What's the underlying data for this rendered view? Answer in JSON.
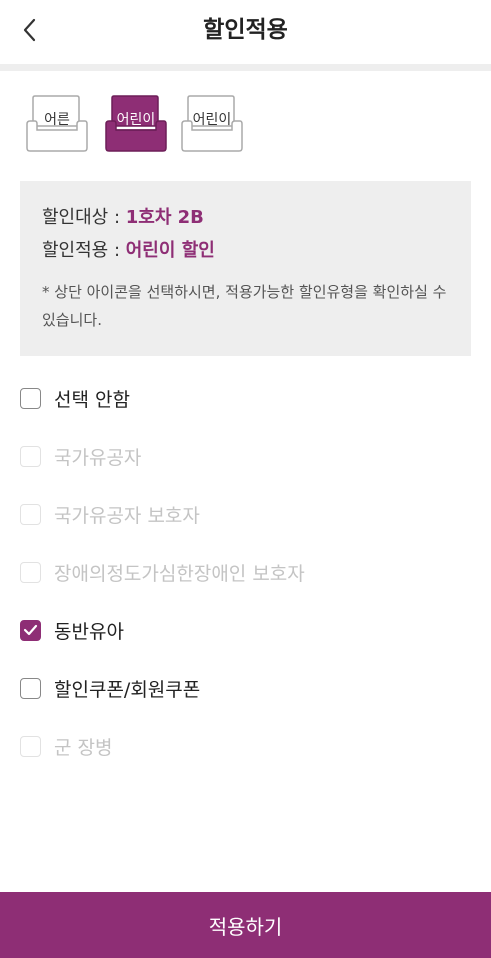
{
  "header": {
    "title": "할인적용",
    "back_icon": "chevron-left-icon"
  },
  "seat_types": [
    {
      "label": "어른",
      "selected": false
    },
    {
      "label": "어린이",
      "selected": true
    },
    {
      "label": "어린이",
      "selected": false
    }
  ],
  "info": {
    "target_label": "할인대상 : ",
    "target_value": "1호차 2B",
    "applied_label": "할인적용 : ",
    "applied_value": "어린이 할인",
    "note": "* 상단 아이콘을 선택하시면, 적용가능한 할인유형을 확인하실 수 있습니다."
  },
  "options": [
    {
      "label": "선택 안함",
      "checked": false,
      "disabled": false
    },
    {
      "label": "국가유공자",
      "checked": false,
      "disabled": true
    },
    {
      "label": "국가유공자 보호자",
      "checked": false,
      "disabled": true
    },
    {
      "label": "장애의정도가심한장애인 보호자",
      "checked": false,
      "disabled": true
    },
    {
      "label": "동반유아",
      "checked": true,
      "disabled": false
    },
    {
      "label": "할인쿠폰/회원쿠폰",
      "checked": false,
      "disabled": false
    },
    {
      "label": "군 장병",
      "checked": false,
      "disabled": true
    }
  ],
  "footer": {
    "apply_label": "적용하기"
  },
  "colors": {
    "accent": "#8e2e75",
    "info_background": "#eeeeee",
    "disabled_text": "#c4c4c4"
  }
}
